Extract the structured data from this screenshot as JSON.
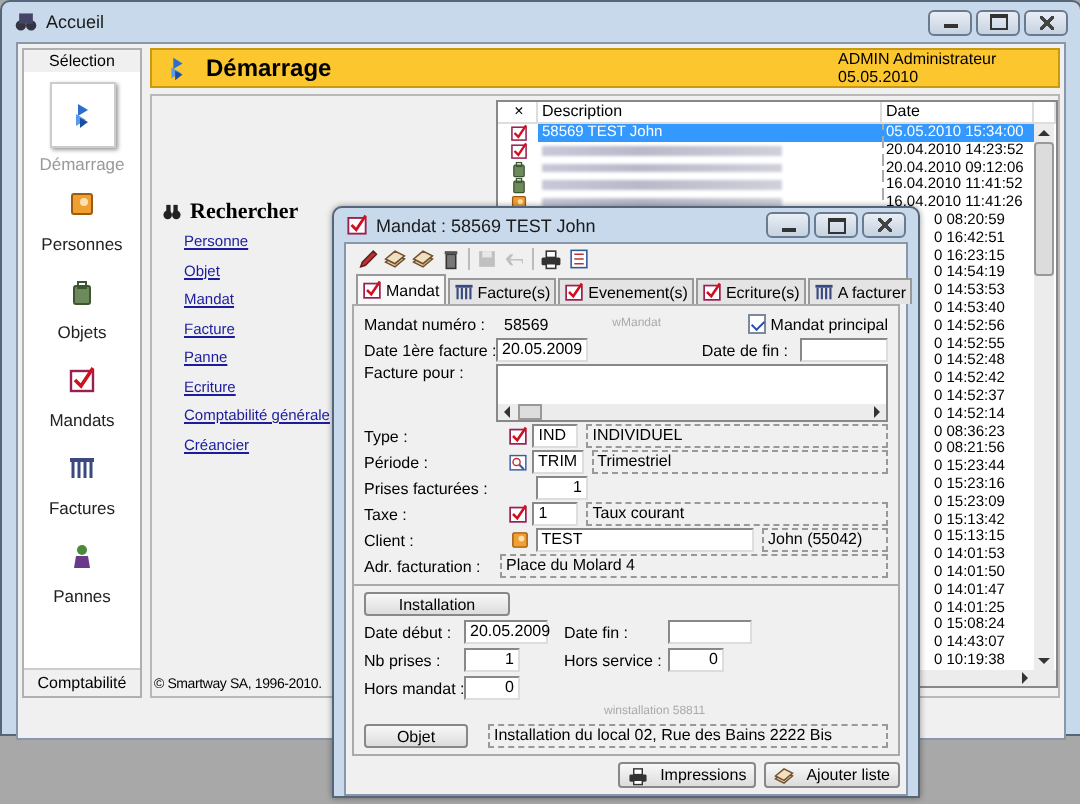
{
  "window": {
    "title": "Accueil"
  },
  "sidebar": {
    "header": "Sélection",
    "items": [
      {
        "label": "Démarrage",
        "kind": "start",
        "selected": true
      },
      {
        "label": "Personnes",
        "kind": "person",
        "selected": false
      },
      {
        "label": "Objets",
        "kind": "object",
        "selected": false
      },
      {
        "label": "Mandats",
        "kind": "mandat",
        "selected": false
      },
      {
        "label": "Factures",
        "kind": "invoice",
        "selected": false
      },
      {
        "label": "Pannes",
        "kind": "breakdown",
        "selected": false
      }
    ],
    "footer": "Comptabilité"
  },
  "header": {
    "title": "Démarrage",
    "user": "ADMIN Administrateur",
    "date": "05.05.2010"
  },
  "search": {
    "title": "Rechercher",
    "links": [
      "Personne",
      "Objet",
      "Mandat",
      "Facture",
      "Panne",
      "Ecriture",
      "Comptabilité générale",
      "Créancier"
    ]
  },
  "copyright": "© Smartway SA, 1996-2010.",
  "recent": {
    "columns": [
      "×",
      "Description",
      "Date"
    ],
    "rows": [
      {
        "kind": "mandat",
        "description": "58569 TEST John",
        "date": "05.05.2010 15:34:00",
        "selected": true,
        "redacted": false,
        "covered": false
      },
      {
        "kind": "mandat",
        "date": "20.04.2010 14:23:52",
        "selected": false,
        "redacted": true,
        "covered": false
      },
      {
        "kind": "object",
        "date": "20.04.2010 09:12:06",
        "selected": false,
        "redacted": true,
        "covered": false
      },
      {
        "kind": "object",
        "date": "16.04.2010 11:41:52",
        "selected": false,
        "redacted": true,
        "covered": false
      },
      {
        "kind": "person",
        "date": "16.04.2010 11:41:26",
        "selected": false,
        "redacted": true,
        "covered": false
      },
      {
        "date": "0 08:20:59",
        "selected": false,
        "covered": true
      },
      {
        "date": "0 16:42:51",
        "selected": false,
        "covered": true
      },
      {
        "date": "0 16:23:15",
        "selected": false,
        "covered": true
      },
      {
        "date": "0 14:54:19",
        "selected": false,
        "covered": true
      },
      {
        "date": "0 14:53:53",
        "selected": false,
        "covered": true
      },
      {
        "date": "0 14:53:40",
        "selected": false,
        "covered": true
      },
      {
        "date": "0 14:52:56",
        "selected": false,
        "covered": true
      },
      {
        "date": "0 14:52:55",
        "selected": false,
        "covered": true
      },
      {
        "date": "0 14:52:48",
        "selected": false,
        "covered": true
      },
      {
        "date": "0 14:52:42",
        "selected": false,
        "covered": true
      },
      {
        "date": "0 14:52:37",
        "selected": false,
        "covered": true
      },
      {
        "date": "0 14:52:14",
        "selected": false,
        "covered": true
      },
      {
        "date": "0 08:36:23",
        "selected": false,
        "covered": true
      },
      {
        "date": "0 08:21:56",
        "selected": false,
        "covered": true
      },
      {
        "date": "0 15:23:44",
        "selected": false,
        "covered": true
      },
      {
        "date": "0 15:23:16",
        "selected": false,
        "covered": true
      },
      {
        "date": "0 15:23:09",
        "selected": false,
        "covered": true
      },
      {
        "date": "0 15:13:42",
        "selected": false,
        "covered": true
      },
      {
        "date": "0 15:13:15",
        "selected": false,
        "covered": true
      },
      {
        "date": "0 14:01:53",
        "selected": false,
        "covered": true
      },
      {
        "date": "0 14:01:50",
        "selected": false,
        "covered": true
      },
      {
        "date": "0 14:01:47",
        "selected": false,
        "covered": true
      },
      {
        "date": "0 14:01:25",
        "selected": false,
        "covered": true
      },
      {
        "date": "0 15:08:24",
        "selected": false,
        "covered": true
      },
      {
        "date": "0 14:43:07",
        "selected": false,
        "covered": true
      },
      {
        "date": "0 10:19:38",
        "selected": false,
        "covered": true
      }
    ]
  },
  "dialog": {
    "title": "Mandat : 58569 TEST John",
    "toolbar": [
      {
        "kind": "pen",
        "disabled": false
      },
      {
        "kind": "books",
        "disabled": false
      },
      {
        "kind": "books",
        "disabled": false
      },
      {
        "kind": "trash",
        "disabled": false
      },
      {
        "kind": "save",
        "disabled": true
      },
      {
        "kind": "undo",
        "disabled": true
      },
      {
        "kind": "printer",
        "disabled": false
      },
      {
        "kind": "sheet",
        "disabled": false
      }
    ],
    "tabs": [
      {
        "label": "Mandat",
        "kind": "mandat",
        "selected": true
      },
      {
        "label": "Facture(s)",
        "kind": "invoice",
        "selected": false
      },
      {
        "label": "Evenement(s)",
        "kind": "mandat",
        "selected": false
      },
      {
        "label": "Ecriture(s)",
        "kind": "mandat",
        "selected": false
      },
      {
        "label": "A facturer",
        "kind": "invoice",
        "selected": false
      }
    ],
    "mandat": {
      "number_label": "Mandat numéro :",
      "number": "58569",
      "tag": "wMandat",
      "principal": {
        "label": "Mandat principal",
        "checked": true
      },
      "first_invoice": {
        "label": "Date 1ère facture :",
        "value": "20.05.2009"
      },
      "end": {
        "label": "Date de fin :"
      },
      "invoice_for": {
        "label": "Facture pour :"
      },
      "rows": [
        {
          "kind": "type",
          "label": "Type :",
          "code": "IND",
          "name": "INDIVIDUEL"
        },
        {
          "kind": "period",
          "label": "Période :",
          "code": "TRIM",
          "name": "Trimestriel"
        },
        {
          "kind": "number",
          "label": "Prises facturées :",
          "value": "1"
        },
        {
          "kind": "tax",
          "label": "Taxe :",
          "code": "1",
          "name": "Taux courant"
        },
        {
          "kind": "client",
          "label": "Client :",
          "code": "TEST",
          "name": "John (55042)"
        },
        {
          "kind": "address",
          "label": "Adr. facturation :",
          "value": "Place du Molard 4"
        }
      ]
    },
    "installation": {
      "button": "Installation",
      "start": {
        "label": "Date début :",
        "value": "20.05.2009"
      },
      "end": {
        "label": "Date fin :"
      },
      "outlets": {
        "label": "Nb prises :",
        "value": "1"
      },
      "out_of_service": {
        "label": "Hors service :",
        "value": "0"
      },
      "out_of_contract": {
        "label": "Hors mandat :",
        "value": "0"
      },
      "tag": "winstallation 58811",
      "object_button": "Objet",
      "object": "Installation du local 02, Rue des Bains 2222 Bis"
    },
    "buttons": [
      {
        "label": "Impressions",
        "kind": "printer"
      },
      {
        "label": "Ajouter liste",
        "kind": "books"
      }
    ]
  }
}
